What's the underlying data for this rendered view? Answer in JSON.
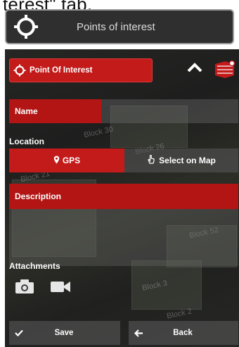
{
  "caption": "terest\" tab.",
  "top_tab": {
    "label": "Points of interest",
    "icon": "crosshair-icon"
  },
  "panel": {
    "header_title": "Point Of Interest",
    "name_label": "Name",
    "location_label": "Location",
    "gps_label": "GPS",
    "select_map_label": "Select on Map",
    "description_label": "Description",
    "attachments_label": "Attachments",
    "save_label": "Save",
    "back_label": "Back",
    "map_labels": [
      "Block 30",
      "Block 26",
      "Block 21",
      "Block 52",
      "Block 3",
      "Block 2"
    ]
  },
  "colors": {
    "accent": "#c31a1a",
    "dark": "#2f2f2f"
  }
}
